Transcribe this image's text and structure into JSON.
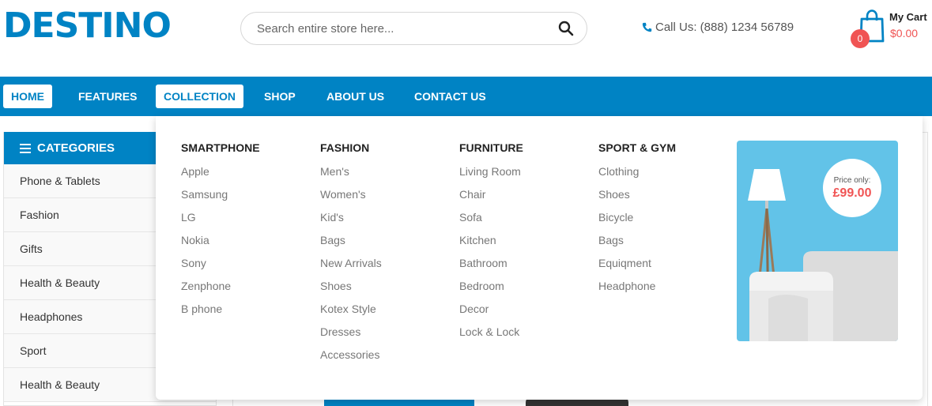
{
  "header": {
    "logo": "DESTINO",
    "search_placeholder": "Search entire store here...",
    "call_label": "Call Us: (888) 1234 56789",
    "cart": {
      "title": "My Cart",
      "total": "$0.00",
      "count": "0"
    }
  },
  "nav": {
    "items": [
      {
        "label": "HOME"
      },
      {
        "label": "FEATURES"
      },
      {
        "label": "COLLECTION"
      },
      {
        "label": "SHOP"
      },
      {
        "label": "ABOUT US"
      },
      {
        "label": "CONTACT US"
      }
    ]
  },
  "sidebar": {
    "title": "CATEGORIES",
    "items": [
      {
        "label": "Phone & Tablets"
      },
      {
        "label": "Fashion"
      },
      {
        "label": "Gifts"
      },
      {
        "label": "Health & Beauty"
      },
      {
        "label": "Headphones"
      },
      {
        "label": "Sport"
      },
      {
        "label": "Health & Beauty"
      }
    ]
  },
  "mega_menu": {
    "columns": [
      {
        "title": "SMARTPHONE",
        "links": [
          "Apple",
          "Samsung",
          "LG",
          "Nokia",
          "Sony",
          "Zenphone",
          "B phone"
        ]
      },
      {
        "title": "FASHION",
        "links": [
          "Men's",
          "Women's",
          "Kid's",
          "Bags",
          "New Arrivals",
          "Shoes",
          "Kotex Style",
          "Dresses",
          "Accessories"
        ]
      },
      {
        "title": "FURNITURE",
        "links": [
          "Living Room",
          "Chair",
          "Sofa",
          "Kitchen",
          "Bathroom",
          "Bedroom",
          "Decor",
          "Lock & Lock"
        ]
      },
      {
        "title": "SPORT & GYM",
        "links": [
          "Clothing",
          "Shoes",
          "Bicycle",
          "Bags",
          "Equiqment",
          "Headphone"
        ]
      }
    ],
    "promo": {
      "price_label": "Price only:",
      "price_value": "£99.00"
    }
  },
  "colors": {
    "brand": "#0083c4",
    "accent": "#f05454"
  }
}
